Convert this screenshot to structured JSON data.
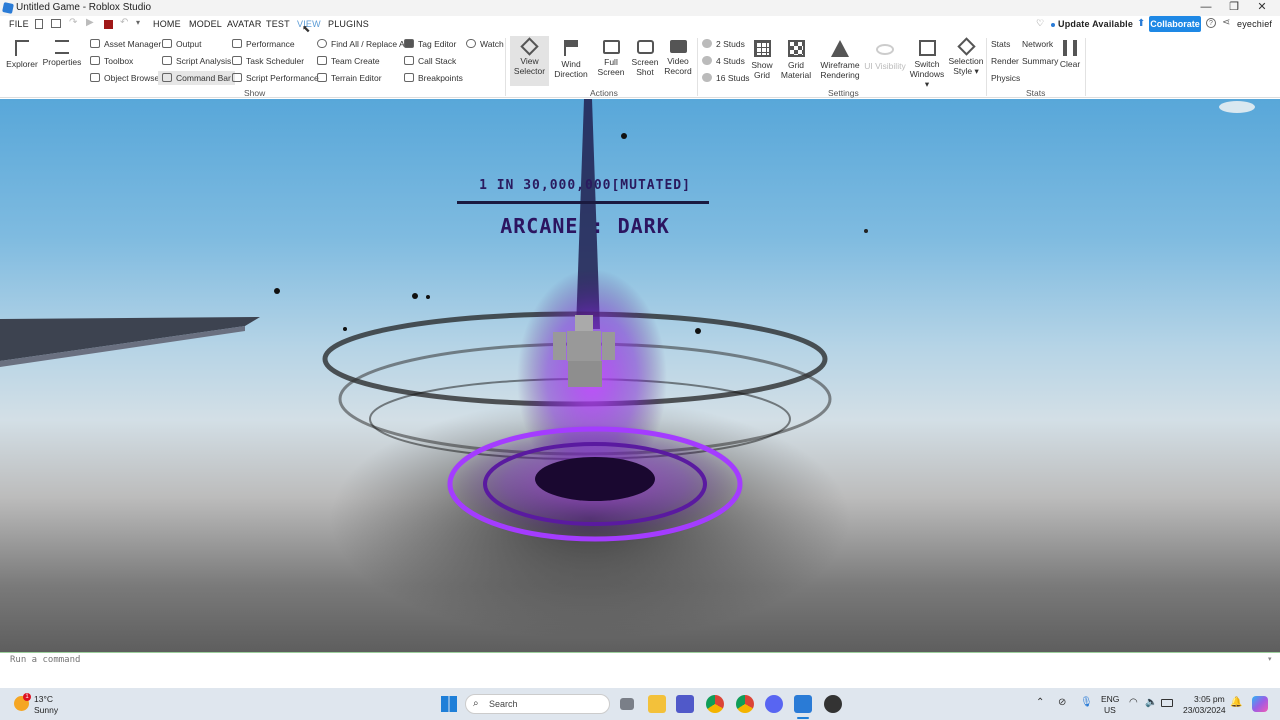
{
  "window": {
    "title": "Untitled Game - Roblox Studio"
  },
  "menu": {
    "file": "FILE",
    "home": "HOME",
    "model": "MODEL",
    "avatar": "AVATAR",
    "test": "TEST",
    "view": "VIEW",
    "plugins": "PLUGINS",
    "update": "Update Available",
    "collaborate": "Collaborate",
    "user": "eyechief"
  },
  "ribbon": {
    "explorer": "Explorer",
    "properties": "Properties",
    "show": {
      "asset_manager": "Asset Manager",
      "toolbox": "Toolbox",
      "object_browser": "Object Browser",
      "output": "Output",
      "script_analysis": "Script Analysis",
      "command_bar": "Command Bar",
      "performance": "Performance",
      "task_scheduler": "Task Scheduler",
      "script_performance": "Script Performance",
      "find_all": "Find All / Replace All",
      "team_create": "Team Create",
      "terrain_editor": "Terrain Editor",
      "tag_editor": "Tag Editor",
      "call_stack": "Call Stack",
      "breakpoints": "Breakpoints",
      "watch": "Watch",
      "group": "Show"
    },
    "actions": {
      "view_selector_1": "View",
      "view_selector_2": "Selector",
      "wind_1": "Wind",
      "wind_2": "Direction",
      "full_1": "Full",
      "full_2": "Screen",
      "shot_1": "Screen",
      "shot_2": "Shot",
      "video_1": "Video",
      "video_2": "Record",
      "group": "Actions"
    },
    "settings": {
      "studs2": "2 Studs",
      "studs4": "4 Studs",
      "studs16": "16 Studs",
      "show_grid_1": "Show",
      "show_grid_2": "Grid",
      "grid_mat_1": "Grid",
      "grid_mat_2": "Material",
      "wire_1": "Wireframe",
      "wire_2": "Rendering",
      "ui_vis": "UI Visibility",
      "switch_1": "Switch",
      "switch_2": "Windows ▾",
      "sel_1": "Selection",
      "sel_2": "Style ▾",
      "group": "Settings"
    },
    "stats": {
      "stats": "Stats",
      "render": "Render",
      "physics": "Physics",
      "network": "Network",
      "summary": "Summary",
      "clear": "Clear",
      "group": "Stats"
    }
  },
  "viewport": {
    "rarity": "1 IN 30,000,000[MUTATED]",
    "aura_name": "ARCANE : DARK"
  },
  "command_bar": {
    "placeholder": "Run a command"
  },
  "taskbar": {
    "temp": "13°C",
    "weather": "Sunny",
    "search": "Search",
    "lang1": "ENG",
    "lang2": "US",
    "time": "3:05 pm",
    "date": "23/03/2024",
    "weather_badge": "1"
  }
}
